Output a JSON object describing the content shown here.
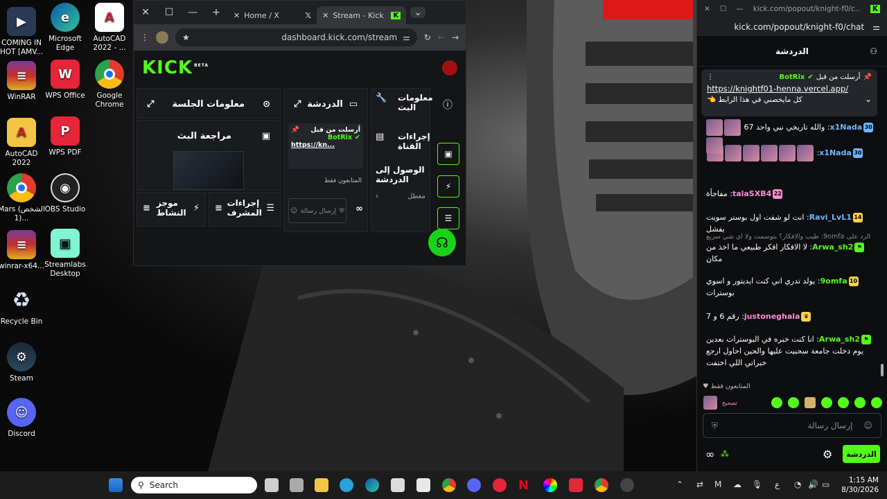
{
  "desktop": {
    "icons": [
      {
        "label": "COMING IN HOT [AMV..."
      },
      {
        "label": "Microsoft Edge"
      },
      {
        "label": "AutoCAD 2022 - ..."
      },
      {
        "label": "WinRAR"
      },
      {
        "label": "WPS Office"
      },
      {
        "label": "Google Chrome"
      },
      {
        "label": "AutoCAD 2022"
      },
      {
        "label": "WPS PDF"
      },
      {
        "label": "Mars (الشخص 1)..."
      },
      {
        "label": "OBS Studio"
      },
      {
        "label": "winrar-x64..."
      },
      {
        "label": "Streamlabs Desktop"
      },
      {
        "label": "Recycle Bin"
      },
      {
        "label": "Steam"
      },
      {
        "label": "Discord"
      }
    ]
  },
  "browser": {
    "tabs": [
      {
        "label": "Home / X"
      },
      {
        "label": "Stream - Kick Da"
      }
    ],
    "url": "dashboard.kick.com/stream",
    "logo": "KICK",
    "logo_sup": "BETA",
    "panels": {
      "session_info": "معلومات الجلسة",
      "chat": "الدردشة",
      "stream_info": "معلومات البث",
      "stream_review": "مراجعة البث",
      "channel_actions": "إجراءات القناة",
      "chat_access": "الوصول إلى الدردشة",
      "chat_access_status": "معطل",
      "activity_summary": "موجز النشاط",
      "mod_actions": "إجراءات المشرف",
      "followers_only": "المتابعون فقط",
      "send_message_placeholder": "إرسال رسالة",
      "pinned_by": "أرسلت من قبل",
      "pinned_user": "BotRix",
      "pinned_link": "https://kn..."
    }
  },
  "popup": {
    "window_url": "kick.com/popout/knight-f0/c...",
    "address": "kick.com/popout/knight-f0/chat",
    "chat_title": "الدردشة",
    "pinned": {
      "label": "أرسلت من قبل",
      "user": "BotRix",
      "link": "https://knightf01-henna.vercel.app/",
      "text": "كل مايخصني في هذا الرابط 👈"
    },
    "messages": [
      {
        "badge": "30",
        "user": "x1Nada",
        "text": "والله تاريخي نبي واحد 67"
      },
      {
        "badge": "30",
        "user": "x1Nada",
        "text": ""
      },
      {
        "badge": "22",
        "user": "talaSXB4",
        "text": "مفاجأة"
      },
      {
        "badge": "14",
        "user": "Ravi_LvL1",
        "text": "انت لو شفت اول بوستر سويت يفشل"
      },
      {
        "badge": "",
        "user": "Arwa_sh2",
        "text": "لا الافكار افكر طبيعي ما اخذ من مكان",
        "reply": "الرد على 9omfa: طيب والافكار؟ يتوسمت ولا اي شي سريع"
      },
      {
        "badge": "10",
        "user": "9omfa",
        "text": "يولد تدري اني كنت ايديتور و اسوي بوسترات"
      },
      {
        "badge": "",
        "user": "justoneghala",
        "text": "رقم 6 و 7"
      },
      {
        "badge": "",
        "user": "Arwa_sh2",
        "text": "انا كنت خبره في البوسترات بعدين يوم دخلت جامعة سحبيت عليها والحين احاول ارجع خبراتي اللي اختفت"
      }
    ],
    "followers_only": "المتابعون فقط",
    "input_placeholder": "إرسال رسالة",
    "chat_button": "الدردشة",
    "reaction_label": "تصحيح"
  },
  "taskbar": {
    "search_placeholder": "Search",
    "time": "1:15 AM",
    "date": "8/30/2026",
    "lang": "ع"
  },
  "colors": {
    "kick_green": "#53fc18",
    "username_blue": "#6fb6ff",
    "username_green": "#53fc18",
    "username_pink": "#ff8ad8",
    "username_yellow": "#ffd04a"
  }
}
